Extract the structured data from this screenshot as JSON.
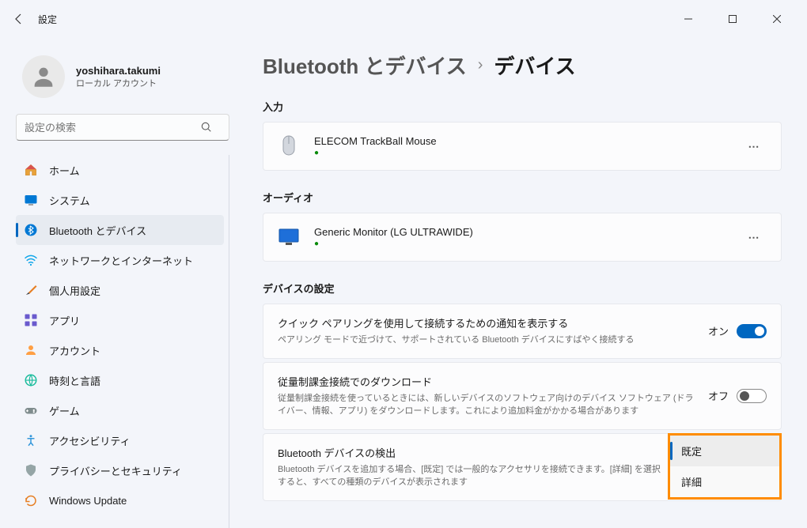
{
  "titlebar": {
    "title": "設定"
  },
  "user": {
    "name": "yoshihara.takumi",
    "sub": "ローカル アカウント"
  },
  "search": {
    "placeholder": "設定の検索"
  },
  "nav": {
    "items": [
      {
        "label": "ホーム"
      },
      {
        "label": "システム"
      },
      {
        "label": "Bluetooth とデバイス"
      },
      {
        "label": "ネットワークとインターネット"
      },
      {
        "label": "個人用設定"
      },
      {
        "label": "アプリ"
      },
      {
        "label": "アカウント"
      },
      {
        "label": "時刻と言語"
      },
      {
        "label": "ゲーム"
      },
      {
        "label": "アクセシビリティ"
      },
      {
        "label": "プライバシーとセキュリティ"
      },
      {
        "label": "Windows Update"
      }
    ]
  },
  "breadcrumb": {
    "parent": "Bluetooth とデバイス",
    "current": "デバイス"
  },
  "sections": {
    "input": {
      "label": "入力",
      "device": {
        "name": "ELECOM TrackBall Mouse",
        "status": "●"
      }
    },
    "audio": {
      "label": "オーディオ",
      "device": {
        "name": "Generic Monitor (LG ULTRAWIDE)",
        "status": "●"
      }
    },
    "device_settings": {
      "label": "デバイスの設定",
      "quick_pair": {
        "title": "クイック ペアリングを使用して接続するための通知を表示する",
        "desc": "ペアリング モードで近づけて、サポートされている Bluetooth デバイスにすばやく接続する",
        "state": "オン"
      },
      "metered": {
        "title": "従量制課金接続でのダウンロード",
        "desc": "従量制課金接続を使っているときには、新しいデバイスのソフトウェア向けのデバイス ソフトウェア (ドライバー、情報、アプリ) をダウンロードします。これにより追加料金がかかる場合があります",
        "state": "オフ"
      },
      "discovery": {
        "title": "Bluetooth デバイスの検出",
        "desc": "Bluetooth デバイスを追加する場合、[既定] では一般的なアクセサリを接続できます。[詳細] を選択すると、すべての種類のデバイスが表示されます",
        "options": {
          "default": "既定",
          "advanced": "詳細"
        }
      }
    }
  }
}
